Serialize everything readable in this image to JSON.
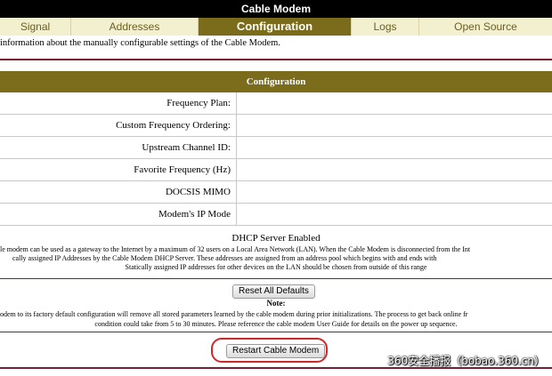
{
  "window": {
    "title": "Cable Modem"
  },
  "tabs": [
    {
      "label": "Signal"
    },
    {
      "label": "Addresses"
    },
    {
      "label": "Configuration",
      "active": true
    },
    {
      "label": "Logs"
    },
    {
      "label": "Open Source"
    }
  ],
  "intro": "information about the manually configurable settings of the Cable Modem.",
  "config": {
    "header": "Configuration",
    "rows": [
      {
        "label": "Frequency Plan:",
        "value": ""
      },
      {
        "label": "Custom Frequency Ordering:",
        "value": ""
      },
      {
        "label": "Upstream Channel ID:",
        "value": ""
      },
      {
        "label": "Favorite Frequency (Hz)",
        "value": ""
      },
      {
        "label": "DOCSIS MIMO",
        "value": ""
      },
      {
        "label": "Modem's IP Mode",
        "value": ""
      }
    ]
  },
  "dhcp": {
    "title": "DHCP Server Enabled",
    "line1": "le modem can be used as a gateway to the Internet by a maximum of 32 users on a Local Area Network (LAN). When the Cable Modem is disconnected from the Int",
    "line2": "cally assigned IP Addresses by the Cable Modem DHCP Server. These addresses are assigned from an address pool which begins with                              and ends with",
    "line3": "Statically assigned IP addresses for other devices on the LAN should be chosen from outside of this range"
  },
  "buttons": {
    "reset": "Reset All Defaults",
    "restart": "Restart Cable Modem"
  },
  "note": {
    "label": "Note:",
    "line1": "odem to its factory default configuration will remove all stored parameters learned by the cable modem during prior initializations. The process to get back online fr",
    "line2": "condition could take from 5 to 30 minutes. Please reference the cable modem User Guide for details on the power up sequence."
  },
  "watermark": "360安全播报（bobao.360.cn）",
  "colors": {
    "accent": "#7b6c1c",
    "tab_bg": "#f3f0cf",
    "rule": "#7a1f2e",
    "highlight": "#cc2a2a"
  }
}
